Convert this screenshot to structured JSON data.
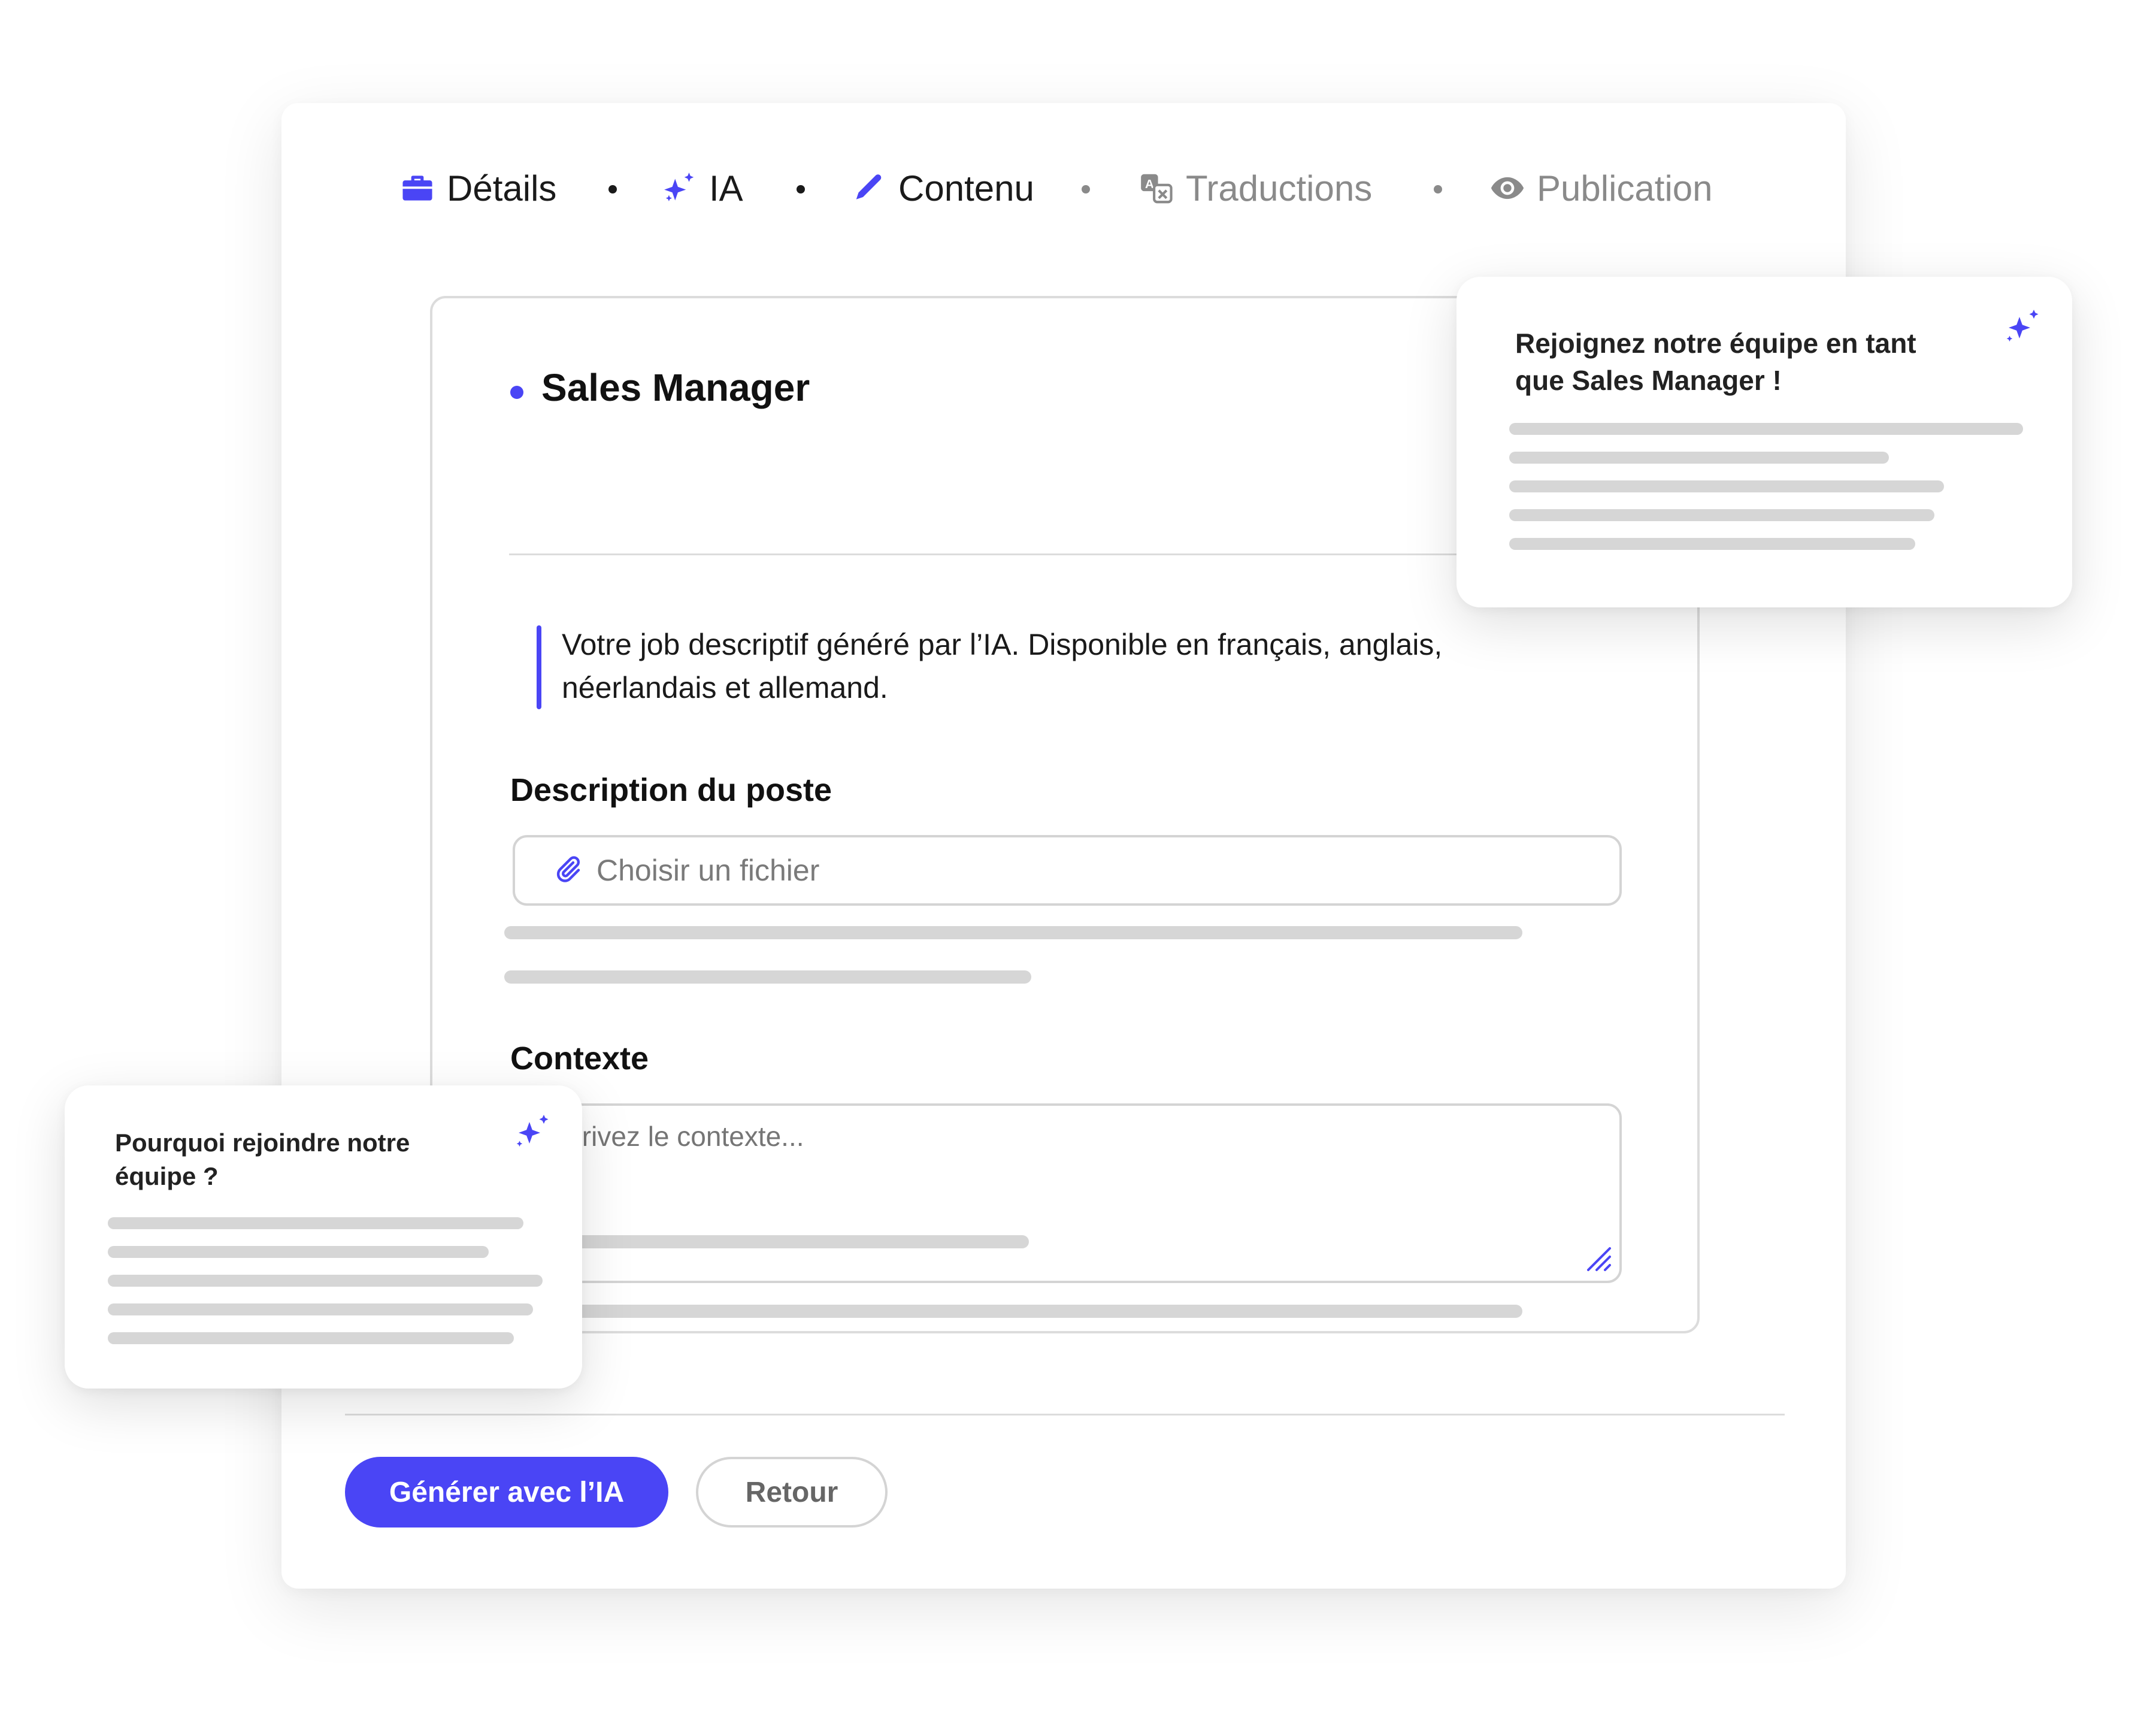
{
  "stepper": {
    "steps": [
      {
        "label": "Détails",
        "icon": "briefcase-icon",
        "state": "active"
      },
      {
        "label": "IA",
        "icon": "sparkles-icon",
        "state": "active"
      },
      {
        "label": "Contenu",
        "icon": "pencil-icon",
        "state": "active"
      },
      {
        "label": "Traductions",
        "icon": "translate-icon",
        "state": "inactive"
      },
      {
        "label": "Publication",
        "icon": "eye-icon",
        "state": "inactive"
      }
    ]
  },
  "form": {
    "job_title": "Sales Manager",
    "info_text": "Votre job descriptif généré par l’IA. Disponible en français, anglais, néerlandais et allemand.",
    "description_label": "Description du poste",
    "file_placeholder": "Choisir un fichier",
    "context_label": "Contexte",
    "context_placeholder": "Décrivez le contexte..."
  },
  "actions": {
    "generate_label": "Générer avec l’IA",
    "back_label": "Retour"
  },
  "cards": {
    "right_title": "Rejoignez notre équipe en tant que Sales Manager !",
    "left_title": "Pourquoi rejoindre  notre équipe ?"
  },
  "colors": {
    "accent": "#4a45f5",
    "text": "#1a1a1a",
    "muted": "#8a8a8a",
    "border": "#d4d4d4",
    "skeleton": "#d6d6d6"
  }
}
